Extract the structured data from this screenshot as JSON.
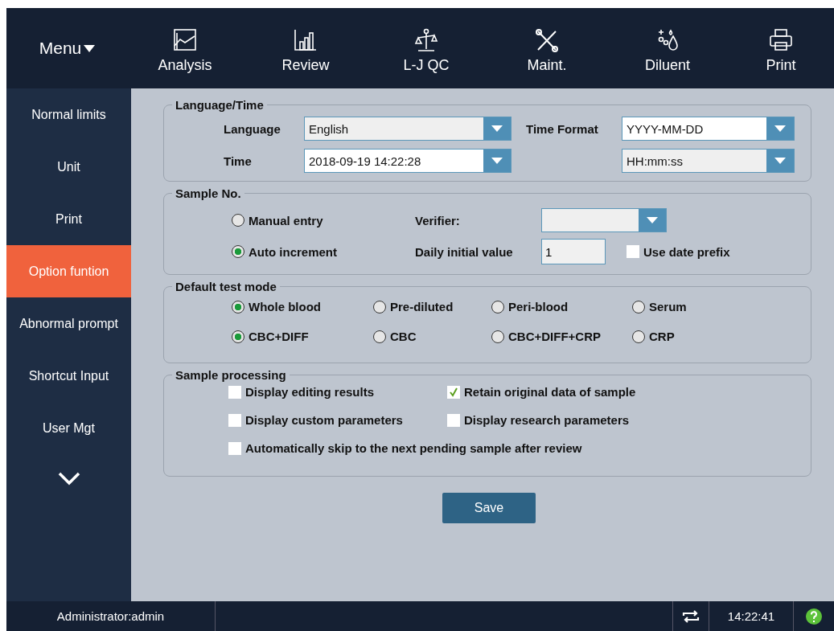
{
  "top_bar": {
    "menu": "Menu",
    "toolbar": [
      {
        "label": "Analysis"
      },
      {
        "label": "Review"
      },
      {
        "label": "L-J QC"
      },
      {
        "label": "Maint."
      },
      {
        "label": "Diluent"
      },
      {
        "label": "Print"
      }
    ]
  },
  "sidebar": {
    "items": [
      {
        "label": "Normal limits",
        "selected": false
      },
      {
        "label": "Unit",
        "selected": false
      },
      {
        "label": "Print",
        "selected": false
      },
      {
        "label": "Option funtion",
        "selected": true
      },
      {
        "label": "Abnormal prompt",
        "selected": false
      },
      {
        "label": "Shortcut Input",
        "selected": false
      },
      {
        "label": "User Mgt",
        "selected": false
      }
    ]
  },
  "language_time": {
    "title": "Language/Time",
    "language": {
      "label": "Language",
      "value": "English"
    },
    "time_format": {
      "label": "Time Format",
      "date_value": "YYYY-MM-DD",
      "time_value": "HH:mm:ss"
    },
    "time": {
      "label": "Time",
      "value": "2018-09-19 14:22:28"
    }
  },
  "sample_no": {
    "title": "Sample No.",
    "modes": [
      {
        "label": "Manual entry",
        "selected": false
      },
      {
        "label": "Auto increment",
        "selected": true
      }
    ],
    "verifier": {
      "label": "Verifier:"
    },
    "daily_initial_value": {
      "label": "Daily initial value",
      "value": "1"
    },
    "use_date_prefix": {
      "label": "Use date prefix",
      "checked": false
    }
  },
  "default_test_mode": {
    "title": "Default test mode",
    "sample_types": [
      {
        "label": "Whole blood",
        "selected": true
      },
      {
        "label": "Pre-diluted",
        "selected": false
      },
      {
        "label": "Peri-blood",
        "selected": false
      },
      {
        "label": "Serum",
        "selected": false
      }
    ],
    "analysis_modes": [
      {
        "label": "CBC+DIFF",
        "selected": true
      },
      {
        "label": "CBC",
        "selected": false
      },
      {
        "label": "CBC+DIFF+CRP",
        "selected": false
      },
      {
        "label": "CRP",
        "selected": false
      }
    ]
  },
  "sample_processing": {
    "title": "Sample processing",
    "options": [
      {
        "label": "Display editing results",
        "checked": false
      },
      {
        "label": "Retain original data of sample",
        "checked": true
      },
      {
        "label": "Display custom parameters",
        "checked": false
      },
      {
        "label": "Display research parameters",
        "checked": false
      },
      {
        "label": "Automatically skip to the next pending sample after review",
        "checked": false
      }
    ]
  },
  "save_button": "Save",
  "status_bar": {
    "user": "Administrator:admin",
    "time": "14:22:41"
  }
}
